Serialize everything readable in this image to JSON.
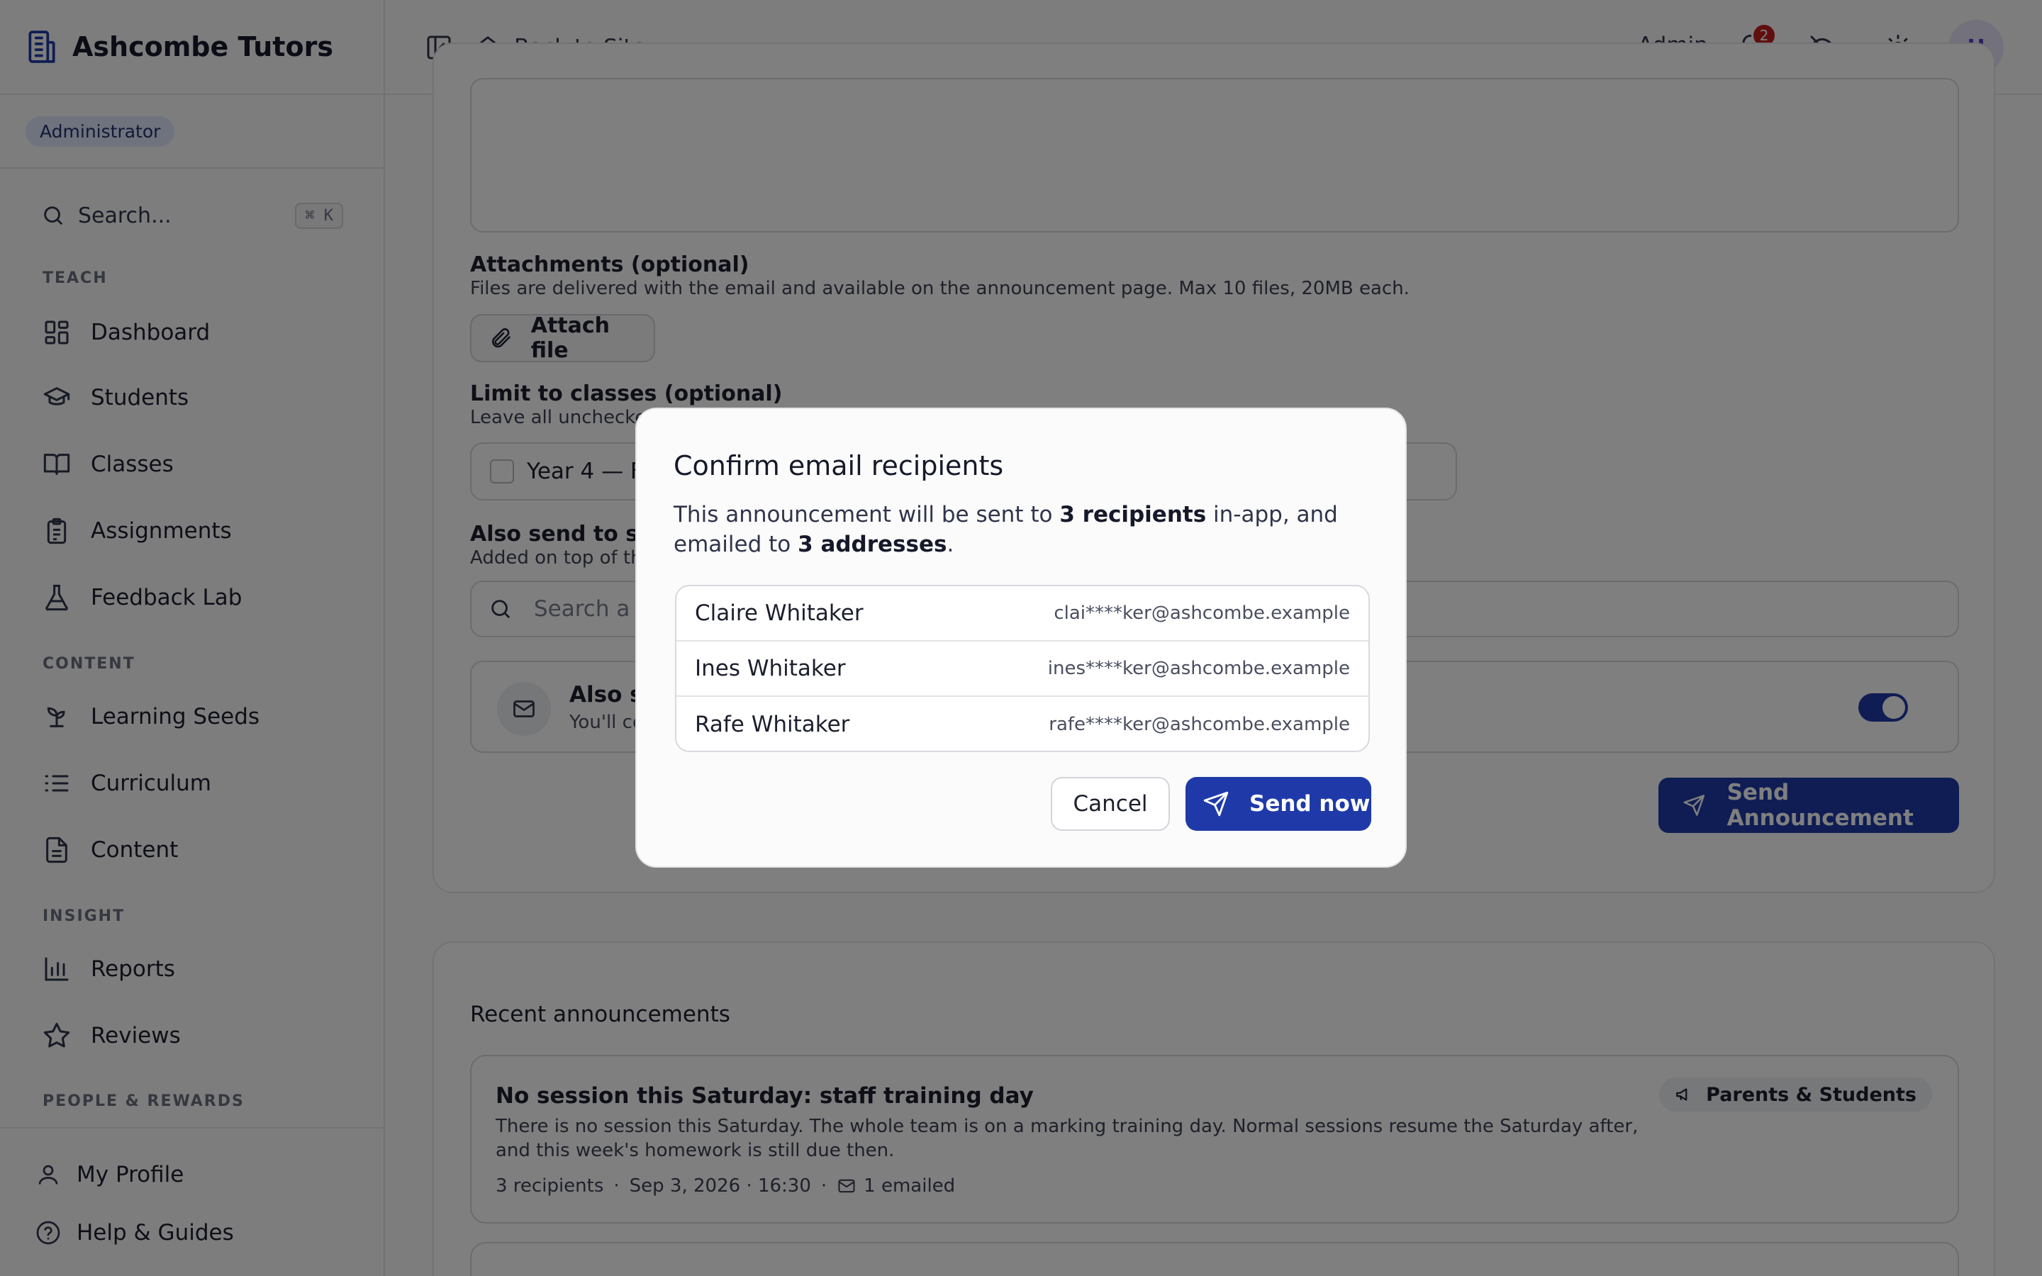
{
  "app": {
    "name": "Ashcombe Tutors",
    "role_badge": "Administrator"
  },
  "sidebar": {
    "search_placeholder": "Search...",
    "search_shortcut": "⌘ K",
    "sections": {
      "teach": "TEACH",
      "content": "CONTENT",
      "insight": "INSIGHT",
      "people": "PEOPLE & REWARDS"
    },
    "items": [
      {
        "label": "Dashboard",
        "icon": "dashboard-icon"
      },
      {
        "label": "Students",
        "icon": "graduation-cap-icon"
      },
      {
        "label": "Classes",
        "icon": "book-open-icon"
      },
      {
        "label": "Assignments",
        "icon": "clipboard-icon"
      },
      {
        "label": "Feedback Lab",
        "icon": "flask-icon"
      },
      {
        "label": "Learning Seeds",
        "icon": "sprout-icon"
      },
      {
        "label": "Curriculum",
        "icon": "list-icon"
      },
      {
        "label": "Content",
        "icon": "file-text-icon"
      },
      {
        "label": "Reports",
        "icon": "bar-chart-icon"
      },
      {
        "label": "Reviews",
        "icon": "star-icon"
      }
    ],
    "bottom": [
      {
        "label": "My Profile",
        "icon": "user-icon"
      },
      {
        "label": "Help & Guides",
        "icon": "help-circle-icon"
      }
    ]
  },
  "topbar": {
    "back_label": "Back to Site",
    "admin_label": "Admin",
    "notification_count": "2",
    "avatar_initial": "H"
  },
  "form": {
    "attachments_label": "Attachments (optional)",
    "attachments_help": "Files are delivered with the email and available on the announcement page. Max 10 files, 20MB each.",
    "attach_button": "Attach file",
    "limit_label": "Limit to classes (optional)",
    "limit_help": "Leave all unchecke",
    "class_option": "Year 4 — F",
    "also_send_label": "Also send to spe",
    "also_send_help": "Added on top of th",
    "search_person_placeholder": "Search a p",
    "email_toggle_title": "Also se",
    "email_toggle_sub": "You'll co",
    "email_toggle_on": true,
    "send_button": "Send Announcement"
  },
  "recent": {
    "title": "Recent announcements",
    "items": [
      {
        "title": "No session this Saturday: staff training day",
        "body": "There is no session this Saturday. The whole team is on a marking training day. Normal sessions resume the Saturday after, and this week's homework is still due then.",
        "recipients": "3 recipients",
        "date": "Sep 3, 2026 · 16:30",
        "emailed": "1 emailed",
        "audience": "Parents & Students"
      }
    ]
  },
  "modal": {
    "title": "Confirm email recipients",
    "desc_prefix": "This announcement will be sent to ",
    "desc_recipients": "3 recipients",
    "desc_middle": " in-app, and emailed to ",
    "desc_addresses": "3 addresses",
    "desc_suffix": ".",
    "recipients": [
      {
        "name": "Claire Whitaker",
        "email": "clai****ker@ashcombe.example"
      },
      {
        "name": "Ines Whitaker",
        "email": "ines****ker@ashcombe.example"
      },
      {
        "name": "Rafe Whitaker",
        "email": "rafe****ker@ashcombe.example"
      }
    ],
    "cancel_label": "Cancel",
    "send_label": "Send now"
  },
  "colors": {
    "primary": "#1f3aa8",
    "badge_red": "#c01f1f",
    "avatar_text": "#5b3bc6",
    "role_badge_bg": "#dfe6fb"
  }
}
